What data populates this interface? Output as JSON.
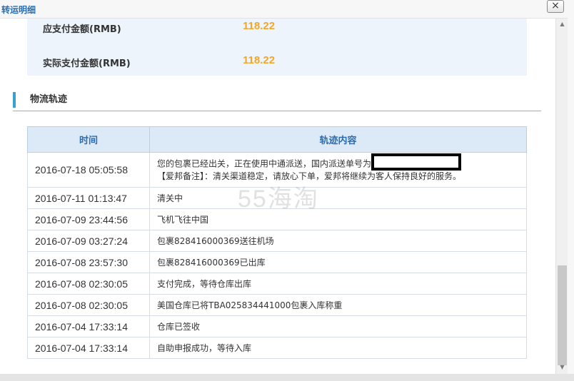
{
  "window": {
    "title": "转运明细",
    "close_glyph": "×"
  },
  "payment": {
    "due_label": "应支付金额(RMB)",
    "due_value": "118.22",
    "paid_label": "实际支付金额(RMB)",
    "paid_value": "118.22"
  },
  "section": {
    "title": "物流轨迹"
  },
  "table": {
    "headers": [
      "时间",
      "轨迹内容"
    ],
    "rows": [
      {
        "time": "2016-07-18 05:05:58",
        "line1": "您的包裹已经出关，正在使用中通派送，国内派送单号为",
        "line2": "【爱邦备注】：清关渠道稳定，请放心下单，爱邦将继续为客人保持良好的服务。"
      },
      {
        "time": "2016-07-11 01:13:47",
        "text": "清关中"
      },
      {
        "time": "2016-07-09 23:44:56",
        "text": "飞机飞往中国"
      },
      {
        "time": "2016-07-09 03:27:24",
        "text": "包裹828416000369送往机场"
      },
      {
        "time": "2016-07-08 23:57:30",
        "text": "包裹828416000369已出库"
      },
      {
        "time": "2016-07-08 02:30:05",
        "text": "支付完成，等待仓库出库"
      },
      {
        "time": "2016-07-08 02:30:05",
        "text": "美国仓库已将TBA025834441000包裹入库称重"
      },
      {
        "time": "2016-07-04 17:33:14",
        "text": "仓库已签收"
      },
      {
        "time": "2016-07-04 17:33:14",
        "text": "自助申报成功，等待入库"
      }
    ]
  },
  "watermark": "55海淘",
  "colors": {
    "accent": "#2a6db0",
    "amount": "#f5a623",
    "header_bg": "#dce9f7"
  }
}
